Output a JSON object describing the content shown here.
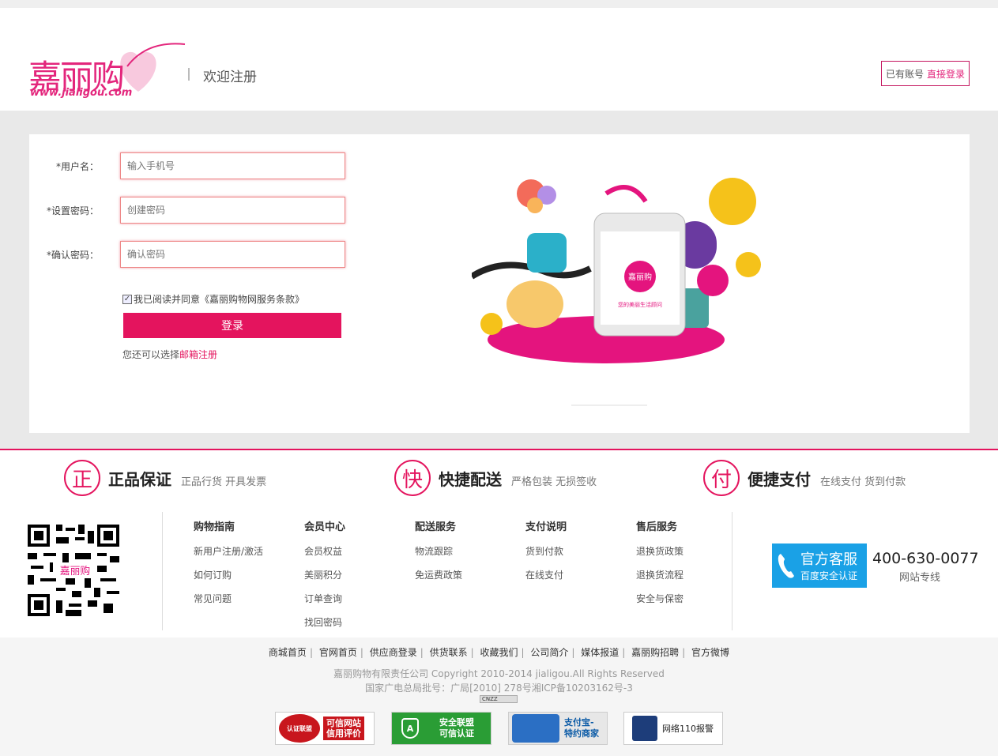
{
  "header": {
    "logo_text": "嘉丽购",
    "logo_url": "www.jialigou.com",
    "welcome": "欢迎注册",
    "have_account": "已有账号",
    "direct_login": "直接登录"
  },
  "form": {
    "username_label": "*用户名：",
    "username_placeholder": "输入手机号",
    "password_label": "*设置密码：",
    "password_placeholder": "创建密码",
    "confirm_label": "*确认密码：",
    "confirm_placeholder": "确认密码",
    "agree_text": "我已阅读并同意《嘉丽购物网服务条款》",
    "agree_checked": true,
    "submit_label": "登录",
    "alt_prefix": "您还可以选择",
    "alt_link": "邮箱注册"
  },
  "illustration": {
    "screen_logo": "嘉丽购",
    "screen_tagline": "您的美丽生活顾问"
  },
  "guarantees": [
    {
      "icon": "正",
      "title": "正品保证",
      "subtitle": "正品行货 开具发票"
    },
    {
      "icon": "快",
      "title": "快捷配送",
      "subtitle": "严格包装 无损签收"
    },
    {
      "icon": "付",
      "title": "便捷支付",
      "subtitle": "在线支付 货到付款"
    }
  ],
  "columns": [
    {
      "title": "购物指南",
      "items": [
        "新用户注册/激活",
        "如何订购",
        "常见问题"
      ]
    },
    {
      "title": "会员中心",
      "items": [
        "会员权益",
        "美丽积分",
        "订单查询",
        "找回密码"
      ]
    },
    {
      "title": "配送服务",
      "items": [
        "物流跟踪",
        "免运费政策"
      ]
    },
    {
      "title": "支付说明",
      "items": [
        "货到付款",
        "在线支付"
      ]
    },
    {
      "title": "售后服务",
      "items": [
        "退换货政策",
        "退换货流程",
        "安全与保密"
      ]
    }
  ],
  "service": {
    "title": "官方客服",
    "subtitle": "百度安全认证",
    "phone": "400-630-0077",
    "phone_label": "网站专线"
  },
  "footer_links": [
    "商城首页",
    "官网首页",
    "供应商登录",
    "供货联系",
    "收藏我们",
    "公司简介",
    "媒体报道",
    "嘉丽购招聘",
    "官方微博"
  ],
  "copyright": "嘉丽购物有限责任公司 Copyright 2010-2014 jialigou.All Rights Reserved",
  "icp": "国家广电总局批号：广局[2010] 278号湘ICP备10203162号-3",
  "cnzz": "CNZZ",
  "badges": [
    {
      "line1": "可信网站",
      "line2": "信用评价",
      "seal": "认证联盟"
    },
    {
      "line1": "安全联盟",
      "line2": "可信认证"
    },
    {
      "line1": "支付宝-",
      "line2": "特约商家"
    },
    {
      "line1": "网络110报警"
    }
  ],
  "colors": {
    "brand": "#e4145e",
    "service_blue": "#1aa1e6"
  }
}
